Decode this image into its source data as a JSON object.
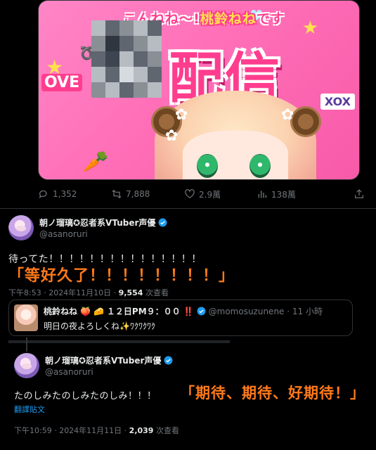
{
  "banner": {
    "greeting": "こんねね～!",
    "name": "桃鈴ねね",
    "desu": "です",
    "title": "配信",
    "deco_ove": "OVE",
    "deco_xox": "XOX"
  },
  "media_actions": {
    "replies": "1,352",
    "retweets": "7,888",
    "likes": "2.9萬",
    "views": "138萬"
  },
  "post1": {
    "display_name": "朝ノ瑠璃✪忍者系VTuber声優",
    "handle": "@asanoruri",
    "text": "待ってた！！！！！！！！！！！！！！！",
    "overlay": "「等好久了！！！！！！！！」",
    "time": "下午8:53 · 2024年11月10日 · ",
    "views_count": "9,554",
    "views_label": " 次查看"
  },
  "quote": {
    "display_name": "桃鈴ねね",
    "name_suffix": "１２日PM９：００",
    "marks": "‼️",
    "handle_time": "@momosuzunene · 11 小時",
    "text": "明日の夜よろしくね✨ﾜｸﾜｸﾜｸ"
  },
  "post3": {
    "display_name": "朝ノ瑠璃✪忍者系VTuber声優",
    "handle": "@asanoruri",
    "text": "たのしみたのしみたのしみ！！！",
    "overlay": "「期待、期待、好期待！」",
    "translate": "翻譯貼文",
    "time": "下午10:59 · 2024年11月11日 · ",
    "views_count": "2,039",
    "views_label": " 次查看"
  },
  "colors": {
    "accent_blue": "#1d9bf0",
    "overlay_orange": "#ff7a1a",
    "banner_pink": "#ff3d8f"
  }
}
